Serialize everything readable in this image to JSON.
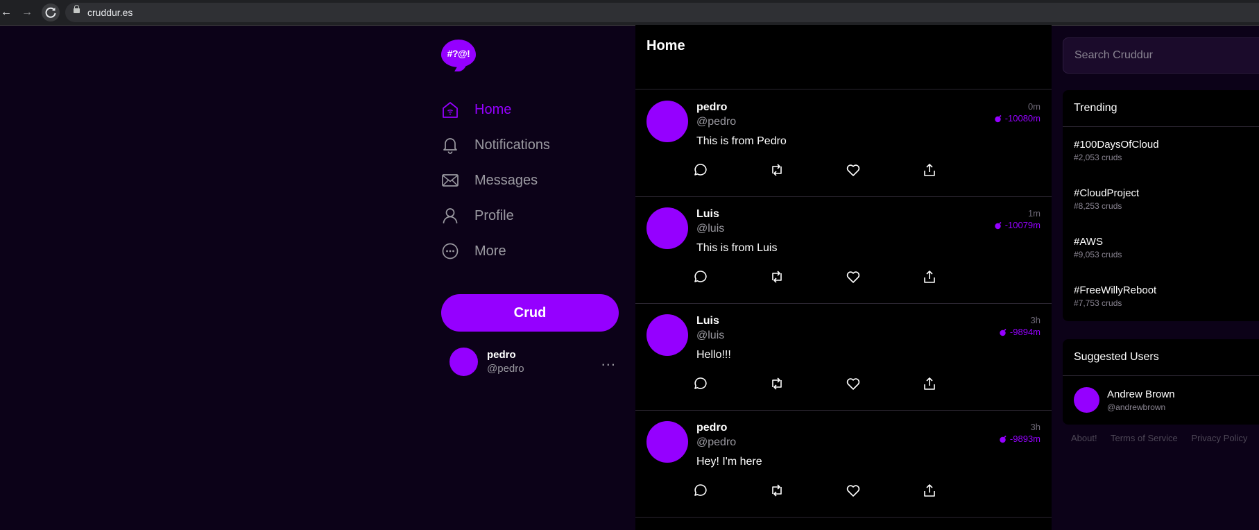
{
  "browser": {
    "url": "cruddur.es"
  },
  "app": {
    "logo_text": "#?@!",
    "accent_color": "#9500ff"
  },
  "sidebar": {
    "items": [
      {
        "label": "Home",
        "icon": "home-icon",
        "active": true
      },
      {
        "label": "Notifications",
        "icon": "bell-icon",
        "active": false
      },
      {
        "label": "Messages",
        "icon": "envelope-icon",
        "active": false
      },
      {
        "label": "Profile",
        "icon": "user-icon",
        "active": false
      },
      {
        "label": "More",
        "icon": "more-circle-icon",
        "active": false
      }
    ],
    "crud_button": "Crud",
    "current_user": {
      "name": "pedro",
      "handle": "@pedro",
      "menu": "..."
    }
  },
  "feed": {
    "title": "Home",
    "posts": [
      {
        "name": "pedro",
        "handle": "@pedro",
        "text": "This is from Pedro",
        "time": "0m",
        "expires": "-10080m"
      },
      {
        "name": "Luis",
        "handle": "@luis",
        "text": "This is from Luis",
        "time": "1m",
        "expires": "-10079m"
      },
      {
        "name": "Luis",
        "handle": "@luis",
        "text": "Hello!!!",
        "time": "3h",
        "expires": "-9894m"
      },
      {
        "name": "pedro",
        "handle": "@pedro",
        "text": "Hey! I'm here",
        "time": "3h",
        "expires": "-9893m"
      }
    ]
  },
  "right": {
    "search_placeholder": "Search Cruddur",
    "trending": {
      "title": "Trending",
      "items": [
        {
          "tag": "#100DaysOfCloud",
          "count": "#2,053 cruds"
        },
        {
          "tag": "#CloudProject",
          "count": "#8,253 cruds"
        },
        {
          "tag": "#AWS",
          "count": "#9,053 cruds"
        },
        {
          "tag": "#FreeWillyReboot",
          "count": "#7,753 cruds"
        }
      ]
    },
    "suggested": {
      "title": "Suggested Users",
      "users": [
        {
          "name": "Andrew Brown",
          "handle": "@andrewbrown"
        }
      ]
    },
    "footer": [
      "About!",
      "Terms of Service",
      "Privacy Policy"
    ]
  }
}
